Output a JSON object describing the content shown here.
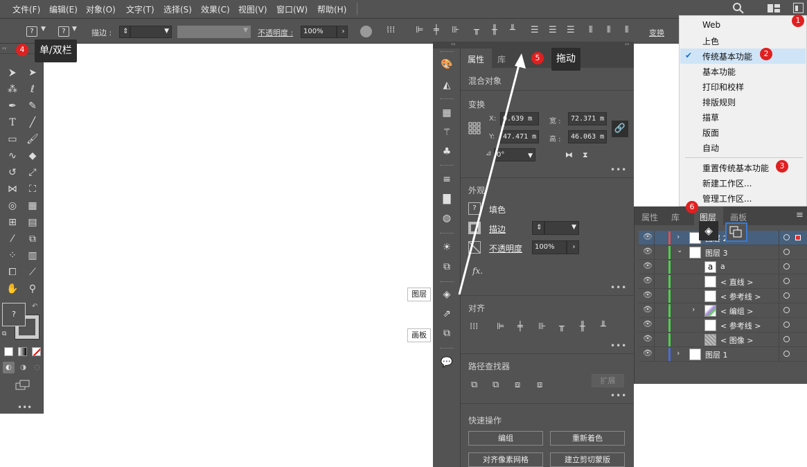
{
  "menu": [
    "文件(F)",
    "编辑(E)",
    "对象(O)",
    "文字(T)",
    "选择(S)",
    "效果(C)",
    "视图(V)",
    "窗口(W)",
    "帮助(H)"
  ],
  "control": {
    "stroke_label": "描边 :",
    "opacity_label": "不透明度 :",
    "opacity_value": "100%",
    "transform_label": "变换"
  },
  "toolbar_tip": "单/双栏",
  "drag_tip": "拖动",
  "panel_labels": {
    "layers": "图层",
    "artboards": "画板"
  },
  "properties": {
    "tabs": [
      "属性",
      "库"
    ],
    "object_type": "混合对象",
    "transform_title": "变换",
    "x_label": "X:",
    "x_value": "0.639 m",
    "y_label": "Y:",
    "y_value": "47.471 m",
    "w_label": "宽 :",
    "w_value": "72.371 m",
    "h_label": "高 :",
    "h_value": "46.063 m",
    "angle_value": "0°",
    "appearance_title": "外观",
    "fill_label": "填色",
    "stroke_label": "描边",
    "opacity_label": "不透明度",
    "opacity_value": "100%",
    "fx_label": "fx.",
    "align_title": "对齐",
    "pathfinder_title": "路径查找器",
    "expand_label": "扩展",
    "quick_title": "快速操作",
    "buttons": [
      "编组",
      "重新着色",
      "对齐像素网格",
      "建立剪切蒙版"
    ]
  },
  "workspace_menu": {
    "items": [
      "Web",
      "上色",
      "传统基本功能",
      "基本功能",
      "打印和校样",
      "排版规则",
      "描草",
      "版面",
      "自动"
    ],
    "checked": "传统基本功能",
    "items2": [
      "重置传统基本功能",
      "新建工作区...",
      "管理工作区..."
    ]
  },
  "layers_panel": {
    "tabs": [
      "属性",
      "库",
      "图层",
      "画板"
    ],
    "rows": [
      {
        "name": "图层 2",
        "color": "#e05050"
      },
      {
        "name": "图层 3",
        "color": "#4cd04c"
      },
      {
        "name": "a",
        "color": "#4cd04c"
      },
      {
        "name": "< 直线 >",
        "color": "#4cd04c"
      },
      {
        "name": "< 参考线 >",
        "color": "#4cd04c"
      },
      {
        "name": "< 编组 >",
        "color": "#4cd04c"
      },
      {
        "name": "< 参考线 >",
        "color": "#4cd04c"
      },
      {
        "name": "< 图像 >",
        "color": "#4cd04c"
      },
      {
        "name": "图层 1",
        "color": "#4a6cd8"
      }
    ]
  },
  "badges": [
    "1",
    "2",
    "3",
    "4",
    "5",
    "6"
  ]
}
